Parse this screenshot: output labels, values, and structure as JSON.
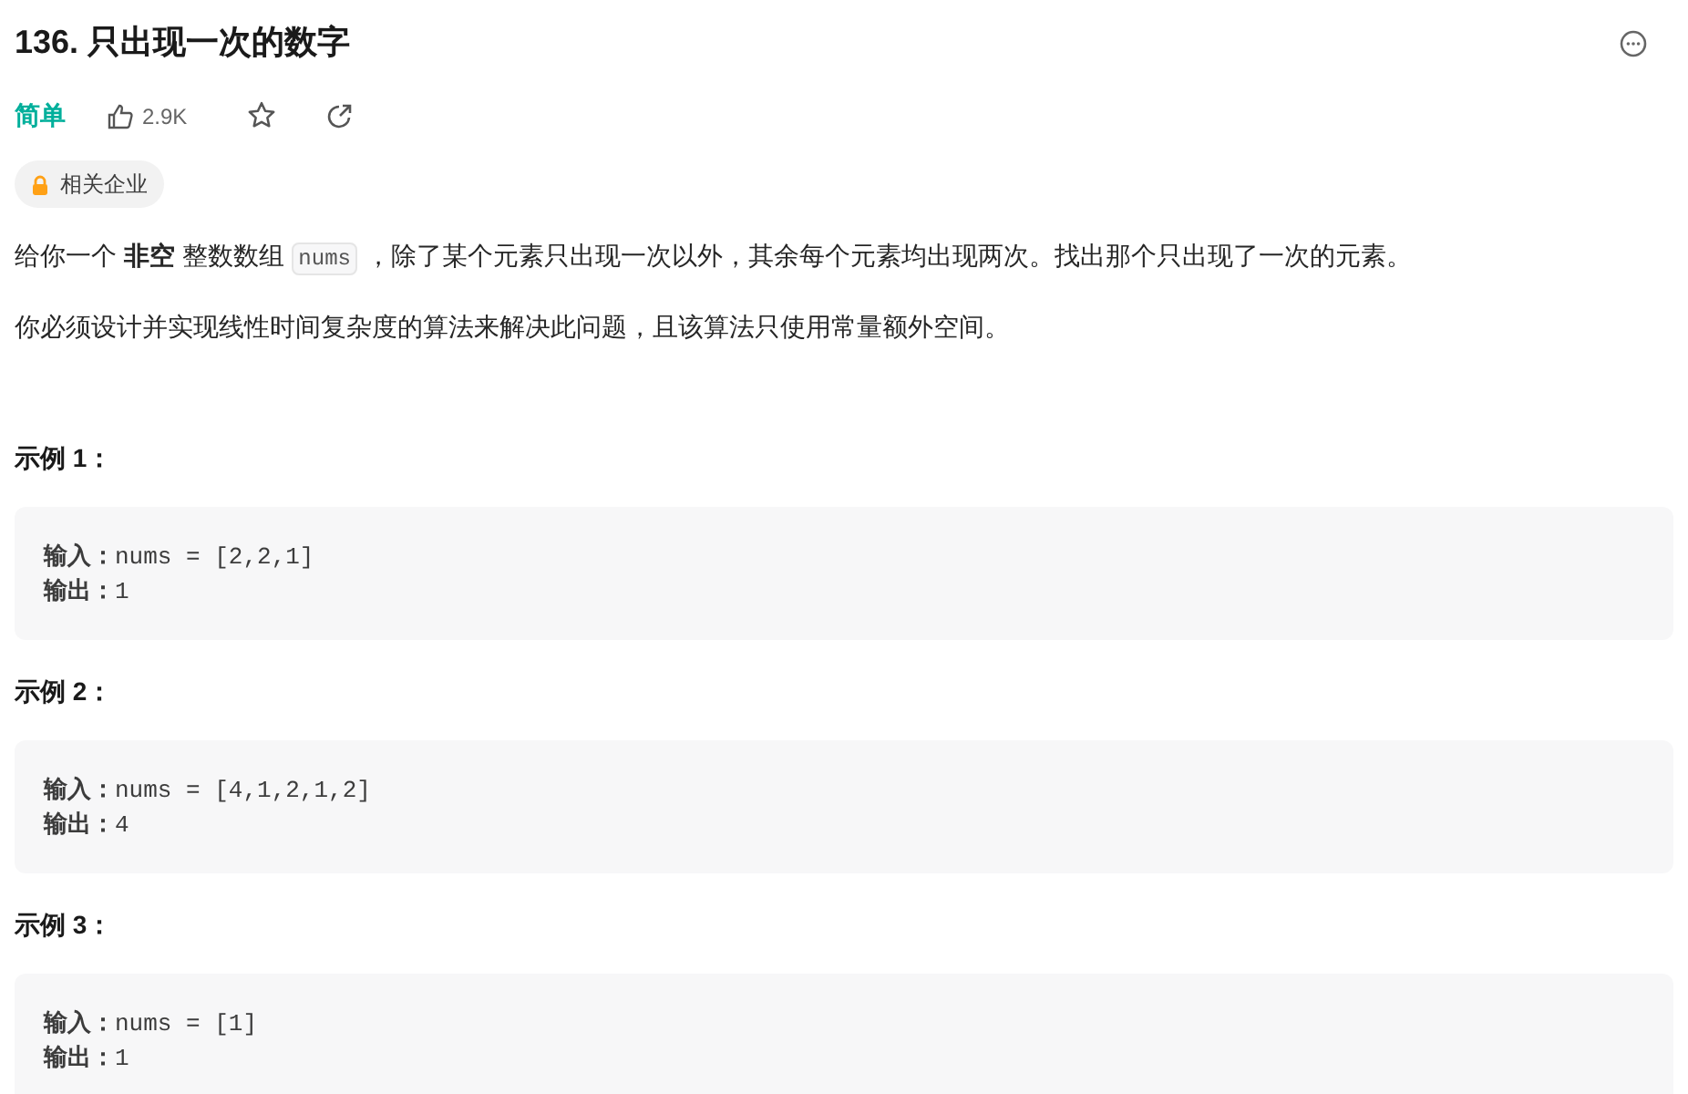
{
  "title": "136. 只出现一次的数字",
  "difficulty": {
    "label": "简单"
  },
  "likes": "2.9K",
  "tag": "相关企业",
  "description": [
    {
      "parts": [
        {
          "kind": "text",
          "text": "给你一个 **非空** 整数数组 "
        },
        {
          "kind": "code",
          "text": "nums"
        },
        {
          "kind": "text",
          "text": " ，除了某个元素只出现一次以外，其余每个元素均出现两次。找出那个只出现了一次的元素。"
        }
      ]
    },
    {
      "parts": [
        {
          "kind": "text",
          "text": "你必须设计并实现线性时间复杂度的算法来解决此问题，且该算法只使用常量额外空间。"
        }
      ]
    }
  ],
  "examples": [
    {
      "label": "示例 1：",
      "lines": [
        "**输入：**nums = [2,2,1]",
        "**输出：**1"
      ]
    },
    {
      "label": "示例 2：",
      "lines": [
        "**输入：**nums = [4,1,2,1,2]",
        "**输出：**4"
      ]
    },
    {
      "label": "示例 3：",
      "lines": [
        "**输入：**nums = [1]",
        "**输出：**1"
      ]
    }
  ]
}
